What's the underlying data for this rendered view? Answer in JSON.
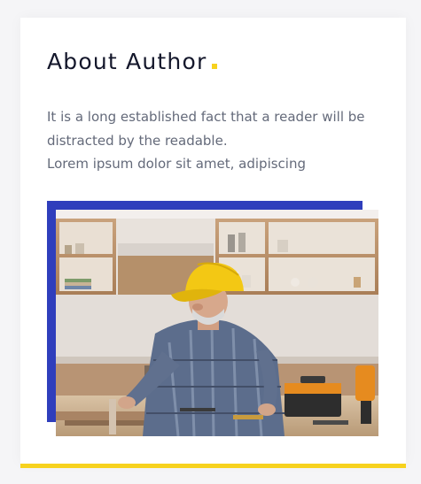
{
  "widget": {
    "title": "About Author",
    "bio_lines": [
      "It is a long established fact that a reader will be distracted by the readable.",
      "Lorem ipsum dolor sit amet, adipiscing"
    ],
    "image": {
      "alt": "Man in a yellow cap working at a table in a kitchen"
    }
  },
  "colors": {
    "accent_yellow": "#f7d21e",
    "frame_blue": "#2f3ebc",
    "title_text": "#14172b",
    "body_text": "#646a7a"
  }
}
